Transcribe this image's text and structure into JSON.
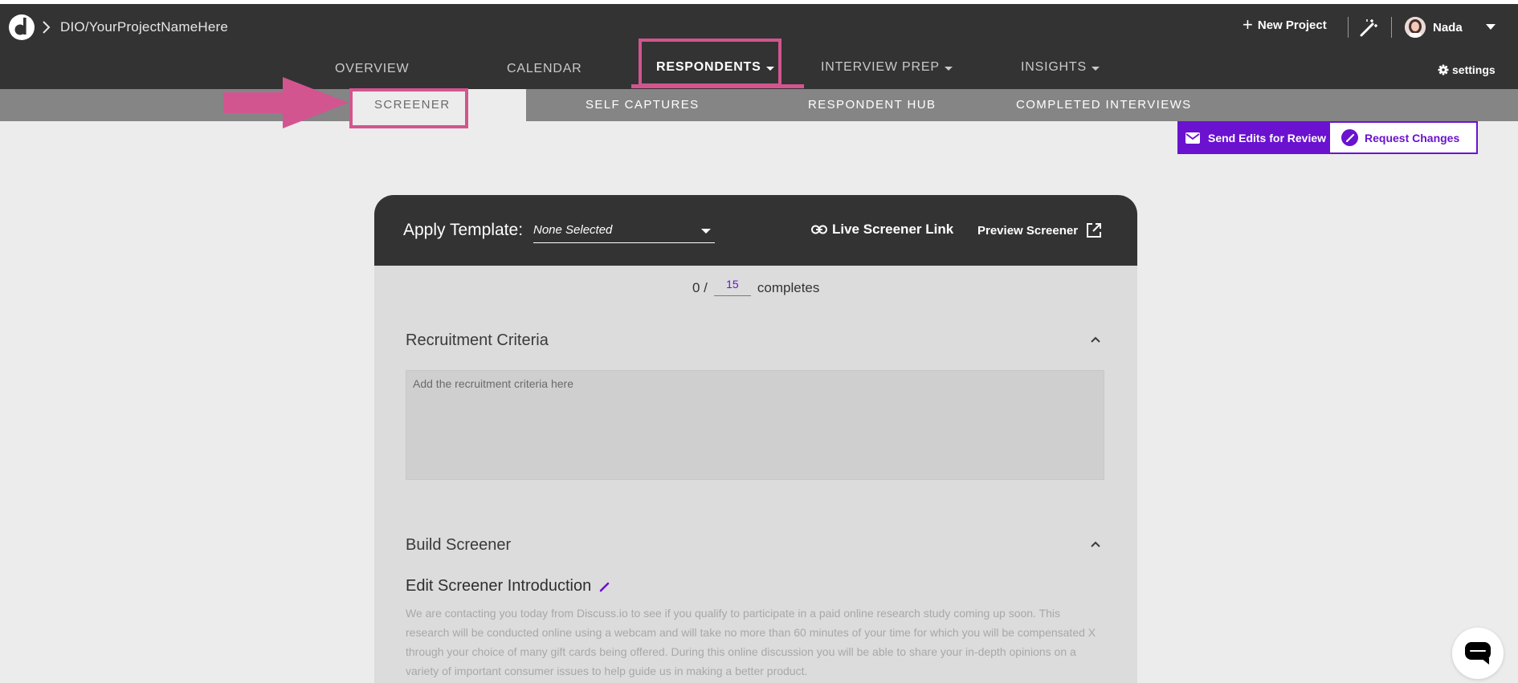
{
  "app": {
    "project_path": "DIO/YourProjectNameHere"
  },
  "header": {
    "new_project_label": "New Project",
    "user_name": "Nada",
    "settings_label": "settings"
  },
  "main_nav": {
    "items": [
      {
        "label": "OVERVIEW",
        "has_caret": false,
        "active": false
      },
      {
        "label": "CALENDAR",
        "has_caret": false,
        "active": false
      },
      {
        "label": "RESPONDENTS",
        "has_caret": true,
        "active": true
      },
      {
        "label": "INTERVIEW PREP",
        "has_caret": true,
        "active": false
      },
      {
        "label": "INSIGHTS",
        "has_caret": true,
        "active": false
      }
    ]
  },
  "sub_nav": {
    "items": [
      {
        "label": "SCREENER",
        "active": true
      },
      {
        "label": "SELF CAPTURES",
        "active": false
      },
      {
        "label": "RESPONDENT HUB",
        "active": false
      },
      {
        "label": "COMPLETED INTERVIEWS",
        "active": false
      }
    ]
  },
  "actions": {
    "send_edits_label": "Send Edits for Review",
    "request_changes_label": "Request Changes"
  },
  "screener": {
    "apply_template_label": "Apply Template:",
    "template_selected": "None Selected",
    "live_link_label": "Live Screener Link",
    "preview_label": "Preview Screener",
    "completes_count": "0 /",
    "completes_target": "15",
    "completes_label": "completes",
    "recruitment_title": "Recruitment Criteria",
    "recruitment_placeholder": "Add the recruitment criteria here",
    "build_title": "Build Screener",
    "intro_title": "Edit Screener Introduction",
    "intro_text": "We are contacting you today from Discuss.io to see if you qualify to participate in a paid online research study coming up soon. This research will be conducted online using a webcam and will take no more than 60 minutes of your time for which you will be compensated X through your choice of many gift cards being offered. During this online discussion you will be able to share your in-depth opinions on a variety of important consumer issues to help guide us in making a better product."
  },
  "colors": {
    "topbar": "#333333",
    "subnav": "#858585",
    "highlight_pink": "#d2558f",
    "accent_purple": "#6a12cf",
    "page_bg": "#ececec",
    "card_body": "#dcdcdc"
  },
  "icons": [
    "discuss-logo-icon",
    "chevron-right-icon",
    "plus-icon",
    "magic-wand-icon",
    "avatar",
    "chevron-down-icon",
    "gear-icon",
    "arrow-right-icon",
    "mail-icon",
    "pencil-icon",
    "link-icon",
    "external-link-icon",
    "chevron-up-icon",
    "chat-icon"
  ]
}
